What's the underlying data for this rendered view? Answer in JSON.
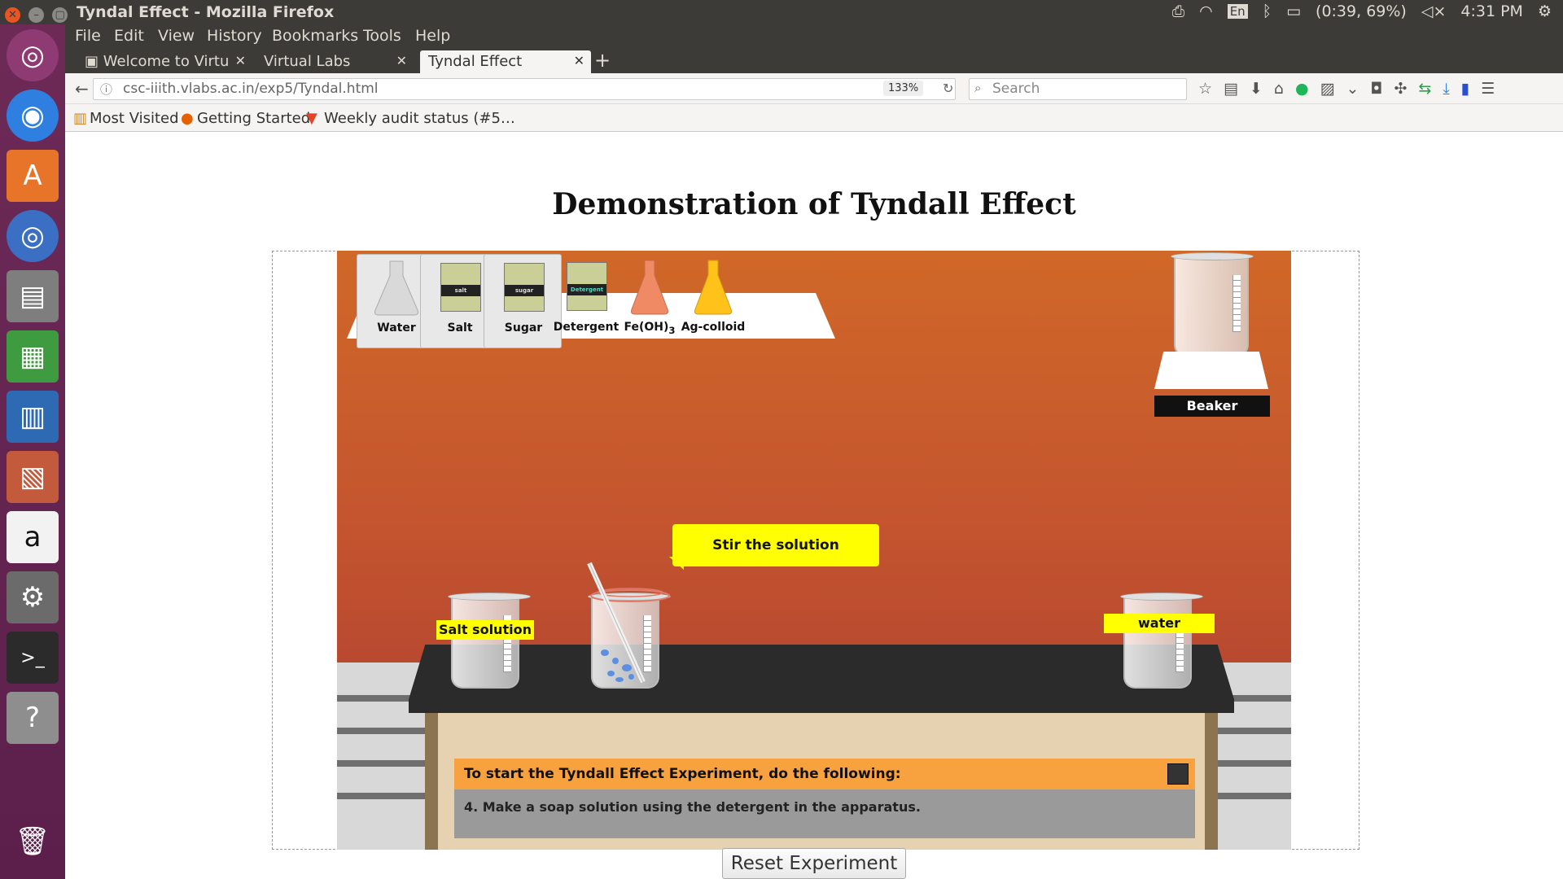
{
  "window": {
    "title": "Tyndal Effect - Mozilla Firefox"
  },
  "system_tray": {
    "language": "En",
    "battery": "(0:39, 69%)",
    "time": "4:31 PM"
  },
  "menu": {
    "file": "File",
    "edit": "Edit",
    "view": "View",
    "history": "History",
    "bookmarks": "Bookmarks",
    "tools": "Tools",
    "help": "Help"
  },
  "tabs": [
    {
      "label": "Welcome to Virtu"
    },
    {
      "label": "Virtual Labs"
    },
    {
      "label": "Tyndal Effect"
    }
  ],
  "address": {
    "url": "csc-iiith.vlabs.ac.in/exp5/Tyndal.html",
    "zoom": "133%"
  },
  "search": {
    "placeholder": "Search"
  },
  "bookmarks_bar": {
    "most_visited": "Most Visited",
    "getting_started": "Getting Started",
    "audit": "Weekly audit status (#5…"
  },
  "page": {
    "title": "Demonstration of Tyndall Effect",
    "chemicals": [
      {
        "label": "Water"
      },
      {
        "label": "Salt",
        "pack_text": "salt"
      },
      {
        "label": "Sugar",
        "pack_text": "sugar"
      },
      {
        "label": "Detergent",
        "pack_text": "Detergent"
      },
      {
        "label": "Fe(OH)",
        "subscript": "3"
      },
      {
        "label": "Ag-colloid"
      }
    ],
    "beaker_label": "Beaker",
    "bubble": "Stir the solution",
    "salt_label": "Salt solution",
    "water_label": "water",
    "instructions": {
      "heading": "To start the Tyndall Effect Experiment, do the following:",
      "step": "4. Make a soap solution using the detergent in the apparatus."
    },
    "reset_button": "Reset Experiment"
  },
  "colors": {
    "stage_top": "#d06828",
    "stage_bottom": "#a93a30",
    "highlight": "#ffff00",
    "instruction_header": "#f7a13f"
  }
}
